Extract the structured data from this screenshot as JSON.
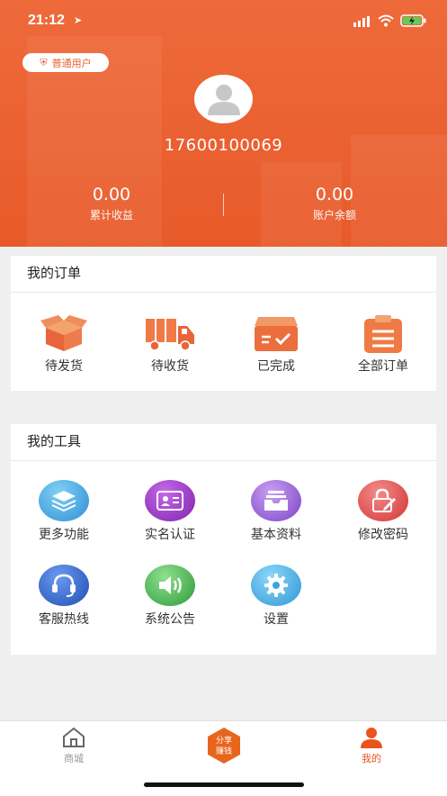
{
  "status_bar": {
    "time": "21:12"
  },
  "profile": {
    "badge": "普通用户",
    "phone": "17600100069",
    "earnings_value": "0.00",
    "earnings_label": "累计收益",
    "balance_value": "0.00",
    "balance_label": "账户余额"
  },
  "orders": {
    "title": "我的订单",
    "items": [
      {
        "label": "待发货",
        "icon": "box-icon"
      },
      {
        "label": "待收货",
        "icon": "truck-icon"
      },
      {
        "label": "已完成",
        "icon": "tray-check-icon"
      },
      {
        "label": "全部订单",
        "icon": "clipboard-icon"
      }
    ]
  },
  "tools": {
    "title": "我的工具",
    "items": [
      {
        "label": "更多功能",
        "icon": "layers-icon",
        "color": "#3aa7e0"
      },
      {
        "label": "实名认证",
        "icon": "id-card-icon",
        "color": "#9b3fc6"
      },
      {
        "label": "基本资料",
        "icon": "archive-icon",
        "color": "#9a57d6"
      },
      {
        "label": "修改密码",
        "icon": "lock-edit-icon",
        "color": "#e24a4a"
      },
      {
        "label": "客服热线",
        "icon": "headset-icon",
        "color": "#2c63c9"
      },
      {
        "label": "系统公告",
        "icon": "speaker-icon",
        "color": "#4bb44b"
      },
      {
        "label": "设置",
        "icon": "gear-icon",
        "color": "#3aa7e0"
      }
    ]
  },
  "tabbar": {
    "mall": "商城",
    "share_line1": "分享",
    "share_line2": "赚钱",
    "mine": "我的",
    "active_color": "#e8541c"
  }
}
